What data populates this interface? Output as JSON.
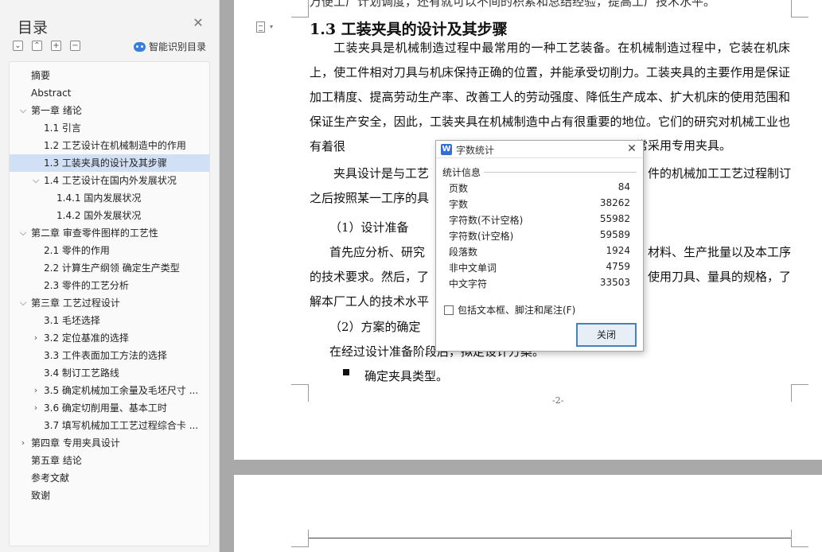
{
  "sidebar": {
    "title": "目录",
    "smart_label": "智能识别目录",
    "items": [
      {
        "label": "摘要",
        "indent": 0,
        "chevron": "",
        "selected": false
      },
      {
        "label": "Abstract",
        "indent": 0,
        "chevron": "",
        "selected": false
      },
      {
        "label": "第一章  绪论",
        "indent": 0,
        "chevron": "down",
        "selected": false
      },
      {
        "label": "1.1  引言",
        "indent": 1,
        "chevron": "",
        "selected": false
      },
      {
        "label": "1.2  工艺设计在机械制造中的作用",
        "indent": 1,
        "chevron": "",
        "selected": false
      },
      {
        "label": "1.3  工装夹具的设计及其步骤",
        "indent": 1,
        "chevron": "",
        "selected": true
      },
      {
        "label": "1.4  工艺设计在国内外发展状况",
        "indent": 1,
        "chevron": "down",
        "selected": false
      },
      {
        "label": "1.4.1  国内发展状况",
        "indent": 2,
        "chevron": "",
        "selected": false
      },
      {
        "label": "1.4.2 国外发展状况",
        "indent": 2,
        "chevron": "",
        "selected": false
      },
      {
        "label": "第二章  审查零件图样的工艺性",
        "indent": 0,
        "chevron": "down",
        "selected": false
      },
      {
        "label": "2.1 零件的作用",
        "indent": 1,
        "chevron": "",
        "selected": false
      },
      {
        "label": "2.2 计算生产纲领  确定生产类型",
        "indent": 1,
        "chevron": "",
        "selected": false
      },
      {
        "label": "2.3  零件的工艺分析",
        "indent": 1,
        "chevron": "",
        "selected": false
      },
      {
        "label": "第三章  工艺过程设计",
        "indent": 0,
        "chevron": "down",
        "selected": false
      },
      {
        "label": "3.1 毛坯选择",
        "indent": 1,
        "chevron": "",
        "selected": false
      },
      {
        "label": "3.2  定位基准的选择",
        "indent": 1,
        "chevron": "right",
        "selected": false
      },
      {
        "label": "3.3  工件表面加工方法的选择",
        "indent": 1,
        "chevron": "",
        "selected": false
      },
      {
        "label": "3.4 制订工艺路线",
        "indent": 1,
        "chevron": "",
        "selected": false
      },
      {
        "label": "3.5 确定机械加工余量及毛坯尺寸 ...",
        "indent": 1,
        "chevron": "right",
        "selected": false
      },
      {
        "label": "3.6 确定切削用量、基本工时",
        "indent": 1,
        "chevron": "right",
        "selected": false
      },
      {
        "label": "3.7 填写机械加工工艺过程综合卡 ...",
        "indent": 1,
        "chevron": "",
        "selected": false
      },
      {
        "label": "第四章  专用夹具设计",
        "indent": 0,
        "chevron": "right",
        "selected": false
      },
      {
        "label": "第五章    结论",
        "indent": 0,
        "chevron": "",
        "selected": false
      },
      {
        "label": "参考文献",
        "indent": 0,
        "chevron": "",
        "selected": false
      },
      {
        "label": "致谢",
        "indent": 0,
        "chevron": "",
        "selected": false
      }
    ]
  },
  "document": {
    "top_cut_line": "万便工厂计划调度，还有就可以不间的积累和总结经验，提高工厂技术水平。",
    "heading": "1.3  工装夹具的设计及其步骤",
    "para1": "工装夹具是机械制造过程中最常用的一种工艺装备。在机械制造过程中，它装在机床上，使工件相对刀具与机床保持正确的位置，并能承受切削力。工装夹具的主要作用是保证加工精度、提高劳动生产率、改善工人的劳动强度、降低生产成本、扩大机床的使用范围和保证生产安全，因此，工装夹具在机械制造中占有很重要的地位。它们的研究对机械工业也有着很",
    "para1_tail": "常采用专用夹具。",
    "para2_a": "夹具设计是与工艺",
    "para2_b": "件的机械加工工艺过程制订",
    "para2_c": "之后按照某一工序的具",
    "step1": "（1）设计准备",
    "para3_a": "首先应分析、研究",
    "para3_b": "材料、生产批量以及本工序",
    "para3_c": "的技术要求。然后，了",
    "para3_d": "使用刀具、量具的规格，了",
    "para3_e": "解本厂工人的技术水平",
    "step2": "（2）方案的确定",
    "para4": "在经过设计准备阶段后，拟定设计方案。",
    "bullet_text": "确定夹具类型。",
    "page_number": "-2-"
  },
  "dialog": {
    "title": "字数统计",
    "section": "统计信息",
    "stats": [
      {
        "label": "页数",
        "value": "84"
      },
      {
        "label": "字数",
        "value": "38262"
      },
      {
        "label": "字符数(不计空格)",
        "value": "55982"
      },
      {
        "label": "字符数(计空格)",
        "value": "59589"
      },
      {
        "label": "段落数",
        "value": "1924"
      },
      {
        "label": "非中文单词",
        "value": "4759"
      },
      {
        "label": "中文字符",
        "value": "33503"
      }
    ],
    "checkbox_label": "包括文本框、脚注和尾注(F)",
    "close_label": "关闭"
  }
}
